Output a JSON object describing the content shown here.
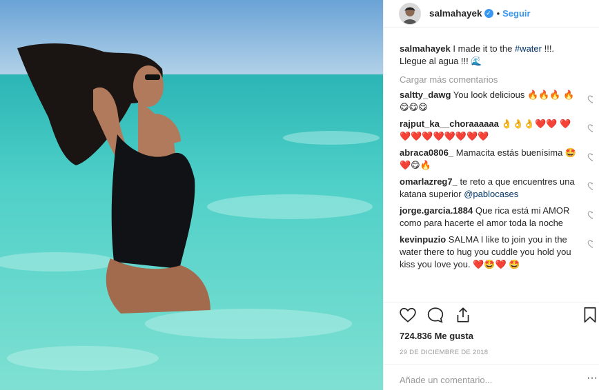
{
  "post": {
    "username": "salmahayek",
    "follow_label": "Seguir",
    "caption_user": "salmahayek",
    "caption_text": " I made it to the ",
    "caption_hashtag": "#water",
    "caption_tail": " !!!. Llegue al agua !!! 🌊",
    "load_more": "Cargar más comentarios",
    "likes": "724.836 Me gusta",
    "date": "29 DE DICIEMBRE DE 2018",
    "add_comment_placeholder": "Añade un comentario...",
    "more_options": "···"
  },
  "comments": [
    {
      "user": "saltty_dawg",
      "text": " You look delicious 🔥🔥🔥 🔥😋😋😋"
    },
    {
      "user": "rajput_ka__choraaaaaa",
      "text": " 👌👌👌❤️❤️ ❤️❤️❤️❤️❤️❤️❤️❤️❤️"
    },
    {
      "user": "abraca0806_",
      "text": " Mamacita estás buenísima 🤩❤️😋🔥"
    },
    {
      "user": "omarlazreg7_",
      "text": " te reto a que encuentres una katana superior ",
      "mention": "@pablocases"
    },
    {
      "user": "jorge.garcia.1884",
      "text": " Que rica está mi AMOR como para hacerte el amor toda la noche"
    },
    {
      "user": "kevinpuzio",
      "text": " SALMA I like to join you in the water there to hug you cuddle you hold you kiss you love you. ❤️🤩❤️ 🤩"
    }
  ],
  "icons": {
    "like": "heart-outline-icon",
    "comment": "comment-bubble-icon",
    "share": "share-icon",
    "save": "bookmark-icon",
    "verified": "verified-badge-icon"
  },
  "colors": {
    "link": "#3897f0",
    "muted": "#999999",
    "text": "#262626",
    "hashtag": "#003569"
  }
}
